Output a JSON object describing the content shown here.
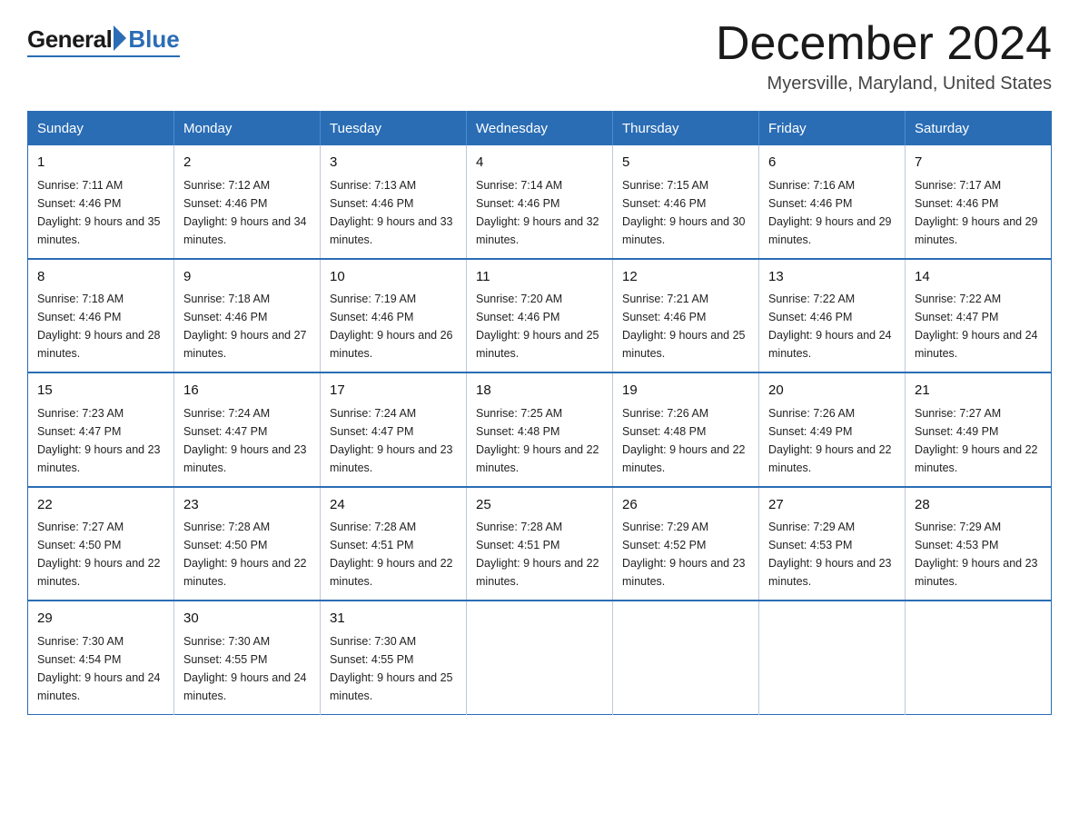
{
  "header": {
    "logo": {
      "general": "General",
      "blue": "Blue"
    },
    "title": "December 2024",
    "location": "Myersville, Maryland, United States"
  },
  "calendar": {
    "days_of_week": [
      "Sunday",
      "Monday",
      "Tuesday",
      "Wednesday",
      "Thursday",
      "Friday",
      "Saturday"
    ],
    "weeks": [
      [
        {
          "day": "1",
          "sunrise": "7:11 AM",
          "sunset": "4:46 PM",
          "daylight": "9 hours and 35 minutes."
        },
        {
          "day": "2",
          "sunrise": "7:12 AM",
          "sunset": "4:46 PM",
          "daylight": "9 hours and 34 minutes."
        },
        {
          "day": "3",
          "sunrise": "7:13 AM",
          "sunset": "4:46 PM",
          "daylight": "9 hours and 33 minutes."
        },
        {
          "day": "4",
          "sunrise": "7:14 AM",
          "sunset": "4:46 PM",
          "daylight": "9 hours and 32 minutes."
        },
        {
          "day": "5",
          "sunrise": "7:15 AM",
          "sunset": "4:46 PM",
          "daylight": "9 hours and 30 minutes."
        },
        {
          "day": "6",
          "sunrise": "7:16 AM",
          "sunset": "4:46 PM",
          "daylight": "9 hours and 29 minutes."
        },
        {
          "day": "7",
          "sunrise": "7:17 AM",
          "sunset": "4:46 PM",
          "daylight": "9 hours and 29 minutes."
        }
      ],
      [
        {
          "day": "8",
          "sunrise": "7:18 AM",
          "sunset": "4:46 PM",
          "daylight": "9 hours and 28 minutes."
        },
        {
          "day": "9",
          "sunrise": "7:18 AM",
          "sunset": "4:46 PM",
          "daylight": "9 hours and 27 minutes."
        },
        {
          "day": "10",
          "sunrise": "7:19 AM",
          "sunset": "4:46 PM",
          "daylight": "9 hours and 26 minutes."
        },
        {
          "day": "11",
          "sunrise": "7:20 AM",
          "sunset": "4:46 PM",
          "daylight": "9 hours and 25 minutes."
        },
        {
          "day": "12",
          "sunrise": "7:21 AM",
          "sunset": "4:46 PM",
          "daylight": "9 hours and 25 minutes."
        },
        {
          "day": "13",
          "sunrise": "7:22 AM",
          "sunset": "4:46 PM",
          "daylight": "9 hours and 24 minutes."
        },
        {
          "day": "14",
          "sunrise": "7:22 AM",
          "sunset": "4:47 PM",
          "daylight": "9 hours and 24 minutes."
        }
      ],
      [
        {
          "day": "15",
          "sunrise": "7:23 AM",
          "sunset": "4:47 PM",
          "daylight": "9 hours and 23 minutes."
        },
        {
          "day": "16",
          "sunrise": "7:24 AM",
          "sunset": "4:47 PM",
          "daylight": "9 hours and 23 minutes."
        },
        {
          "day": "17",
          "sunrise": "7:24 AM",
          "sunset": "4:47 PM",
          "daylight": "9 hours and 23 minutes."
        },
        {
          "day": "18",
          "sunrise": "7:25 AM",
          "sunset": "4:48 PM",
          "daylight": "9 hours and 22 minutes."
        },
        {
          "day": "19",
          "sunrise": "7:26 AM",
          "sunset": "4:48 PM",
          "daylight": "9 hours and 22 minutes."
        },
        {
          "day": "20",
          "sunrise": "7:26 AM",
          "sunset": "4:49 PM",
          "daylight": "9 hours and 22 minutes."
        },
        {
          "day": "21",
          "sunrise": "7:27 AM",
          "sunset": "4:49 PM",
          "daylight": "9 hours and 22 minutes."
        }
      ],
      [
        {
          "day": "22",
          "sunrise": "7:27 AM",
          "sunset": "4:50 PM",
          "daylight": "9 hours and 22 minutes."
        },
        {
          "day": "23",
          "sunrise": "7:28 AM",
          "sunset": "4:50 PM",
          "daylight": "9 hours and 22 minutes."
        },
        {
          "day": "24",
          "sunrise": "7:28 AM",
          "sunset": "4:51 PM",
          "daylight": "9 hours and 22 minutes."
        },
        {
          "day": "25",
          "sunrise": "7:28 AM",
          "sunset": "4:51 PM",
          "daylight": "9 hours and 22 minutes."
        },
        {
          "day": "26",
          "sunrise": "7:29 AM",
          "sunset": "4:52 PM",
          "daylight": "9 hours and 23 minutes."
        },
        {
          "day": "27",
          "sunrise": "7:29 AM",
          "sunset": "4:53 PM",
          "daylight": "9 hours and 23 minutes."
        },
        {
          "day": "28",
          "sunrise": "7:29 AM",
          "sunset": "4:53 PM",
          "daylight": "9 hours and 23 minutes."
        }
      ],
      [
        {
          "day": "29",
          "sunrise": "7:30 AM",
          "sunset": "4:54 PM",
          "daylight": "9 hours and 24 minutes."
        },
        {
          "day": "30",
          "sunrise": "7:30 AM",
          "sunset": "4:55 PM",
          "daylight": "9 hours and 24 minutes."
        },
        {
          "day": "31",
          "sunrise": "7:30 AM",
          "sunset": "4:55 PM",
          "daylight": "9 hours and 25 minutes."
        },
        null,
        null,
        null,
        null
      ]
    ]
  }
}
